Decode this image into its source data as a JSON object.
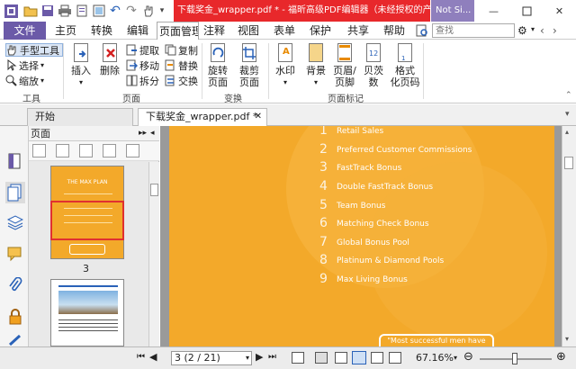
{
  "window": {
    "title_doc": "下载奖金_wrapper.pdf *",
    "title_app": " - 福昕高级PDF编辑器（未经授权的产品）",
    "title_extra": "Not Si...",
    "minimize": "—",
    "close": "✕"
  },
  "menu": {
    "file": "文件",
    "tabs": [
      "主页",
      "转换",
      "编辑",
      "页面管理",
      "注释",
      "视图",
      "表单",
      "保护",
      "共享",
      "帮助"
    ],
    "search_placeholder": "查找"
  },
  "ribbon": {
    "tools": {
      "hand": "手型工具",
      "select": "选择",
      "zoom": "缩放",
      "group": "工具"
    },
    "pages": {
      "insert": "插入",
      "delete": "删除",
      "extract": "提取",
      "move": "移动",
      "split": "拆分",
      "copy": "复制",
      "replace": "替换",
      "swap": "交换",
      "group": "页面"
    },
    "transform": {
      "rotate": "旋转\n页面",
      "crop": "裁剪\n页面",
      "group": "变换"
    },
    "marks": {
      "watermark": "水印",
      "background": "背景",
      "header_footer": "页眉/\n页脚",
      "bates": "贝茨\n数",
      "format": "格式\n化页码",
      "group": "页面标记"
    }
  },
  "doctabs": {
    "start": "开始",
    "current": "下载奖金_wrapper.pdf *"
  },
  "thumbs": {
    "panel_title": "页面",
    "page_label_1": "3",
    "thumb_title": "THE MAX PLAN"
  },
  "document": {
    "items": [
      {
        "n": "1",
        "t": "Retail Sales"
      },
      {
        "n": "2",
        "t": "Preferred Customer Commissions"
      },
      {
        "n": "3",
        "t": "FastTrack Bonus"
      },
      {
        "n": "4",
        "t": "Double FastTrack Bonus"
      },
      {
        "n": "5",
        "t": "Team Bonus"
      },
      {
        "n": "6",
        "t": "Matching Check Bonus"
      },
      {
        "n": "7",
        "t": "Global Bonus Pool"
      },
      {
        "n": "8",
        "t": "Platinum & Diamond Pools"
      },
      {
        "n": "9",
        "t": "Max Living Bonus"
      }
    ],
    "quote": "\"Most successful men have"
  },
  "status": {
    "page": "3 (2 / 21)",
    "zoom": "67.16%"
  },
  "colors": {
    "accent": "#6b5aa8",
    "title_red": "#e8282b",
    "page_orange": "#f3a92a"
  }
}
